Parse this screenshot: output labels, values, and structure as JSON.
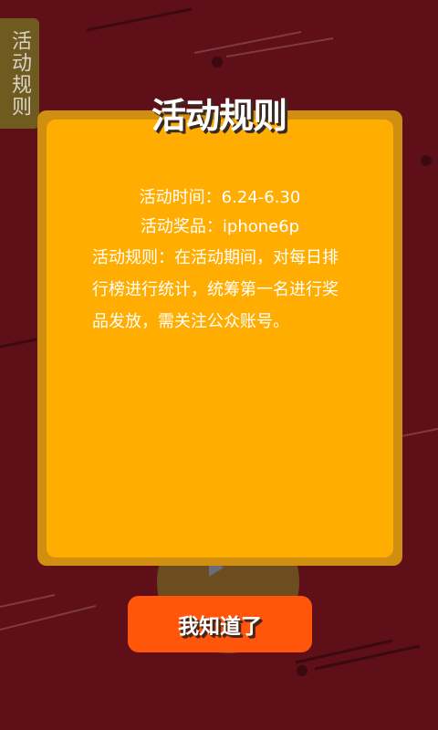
{
  "side_tab": {
    "label": "活动规则"
  },
  "dialog": {
    "title": "活动规则",
    "time_line": "活动时间：6.24-6.30",
    "prize_line": "活动奖品：iphone6p",
    "rules_text": "活动规则：在活动期间，对每日排行榜进行统计，统筹第一名进行奖品发放，需关注公众账号。",
    "confirm_label": "我知道了"
  },
  "colors": {
    "background": "#5e0f17",
    "card_outer": "#d18f12",
    "card_inner": "#ffad00",
    "button": "#ff560b",
    "side_tab": "#6f5b1f"
  }
}
